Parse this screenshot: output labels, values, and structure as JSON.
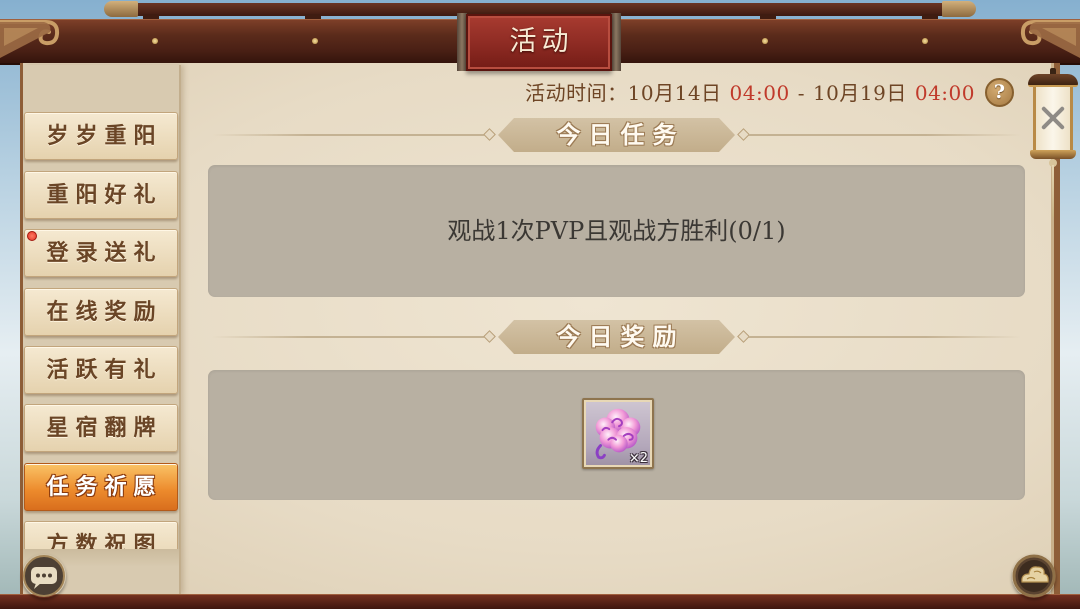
{
  "window": {
    "title": "活动"
  },
  "event_time": {
    "label": "活动时间：",
    "start_date": "10月14日",
    "start_time": "04:00",
    "separator": "-",
    "end_date": "10月19日",
    "end_time": "04:00"
  },
  "help": {
    "label": "?",
    "icon": "question-icon"
  },
  "close": {
    "icon": "close-icon"
  },
  "sidebar": {
    "items": [
      {
        "label": "岁岁重阳",
        "selected": false,
        "notification": false
      },
      {
        "label": "重阳好礼",
        "selected": false,
        "notification": false
      },
      {
        "label": "登录送礼",
        "selected": false,
        "notification": true
      },
      {
        "label": "在线奖励",
        "selected": false,
        "notification": false
      },
      {
        "label": "活跃有礼",
        "selected": false,
        "notification": false
      },
      {
        "label": "星宿翻牌",
        "selected": false,
        "notification": false
      },
      {
        "label": "任务祈愿",
        "selected": true,
        "notification": false
      },
      {
        "label": "方数祝图",
        "selected": false,
        "notification": false
      }
    ]
  },
  "task_section": {
    "title": "今日任务",
    "description": "观战1次PVP且观战方胜利",
    "progress": "(0/1)"
  },
  "reward_section": {
    "title": "今日奖励",
    "items": [
      {
        "icon": "pink-cloud-icon",
        "quantity": "×2"
      }
    ]
  },
  "bottom_controls": {
    "left_icon": "chat-icon",
    "right_icon": "cloud-emblem-icon"
  },
  "colors": {
    "time_highlight": "#c03a2b",
    "selected_tab": "#ec8a2c",
    "notification_dot": "#e3362a",
    "title_banner": "#8f2c24",
    "panel": "#b8b0a2"
  }
}
